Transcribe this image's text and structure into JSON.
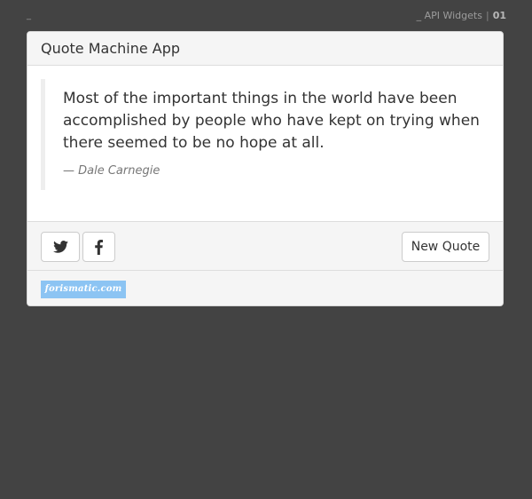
{
  "header": {
    "dash": "_",
    "brand_prefix": "_ API Widgets",
    "separator": "|",
    "number": "01"
  },
  "app": {
    "title": "Quote Machine App"
  },
  "quote": {
    "text": "Most of the important things in the world have been accomplished by people who have kept on trying when there seemed to be no hope at all.",
    "author": "— Dale Carnegie"
  },
  "actions": {
    "twitter_icon": "twitter-icon",
    "facebook_icon": "facebook-icon",
    "new_quote_label": "New Quote"
  },
  "credits": {
    "logo_text": "forismatic.com",
    "logo_color": "#8cc4f3"
  },
  "colors": {
    "background": "#434343",
    "panel": "#ffffff",
    "panel_muted": "#f5f5f5"
  }
}
